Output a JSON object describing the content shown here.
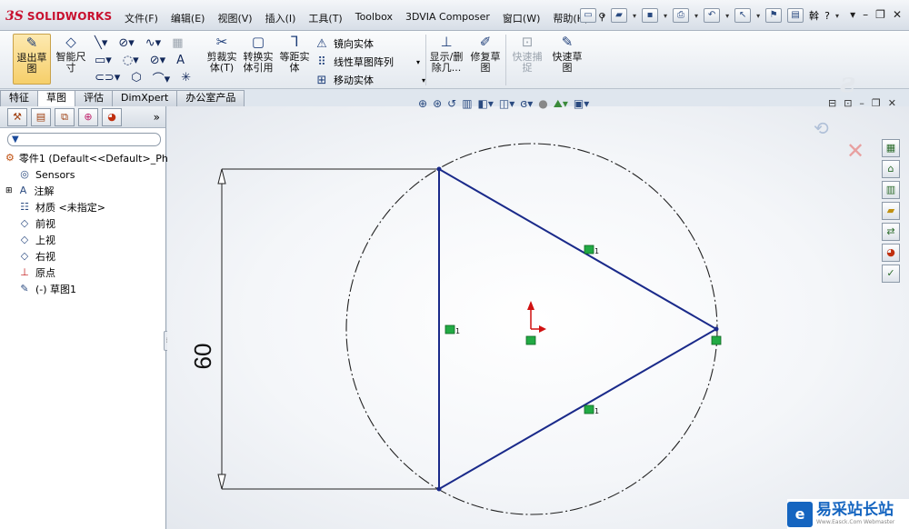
{
  "app": {
    "logo_ds": "3S",
    "logo_name": "SOLIDWORKS"
  },
  "menu": [
    "文件(F)",
    "编辑(E)",
    "视图(V)",
    "插入(I)",
    "工具(T)",
    "Toolbox",
    "3DVIA Composer",
    "窗口(W)",
    "帮助(H)"
  ],
  "toolbar_right": {
    "more_label": "斡",
    "help_label": "?"
  },
  "command_manager": {
    "exit_sketch": "退出草图",
    "smart_dim": "智能尺寸",
    "trim": "剪裁实体(T)",
    "convert": "转换实体引用",
    "offset": "等距实体",
    "mirror": "镜向实体",
    "linear_pattern": "线性草图阵列",
    "move": "移动实体",
    "display_delete": "显示/删除几...",
    "repair": "修复草图",
    "quick_snap": "快速捕捉",
    "rapid_sketch": "快速草图"
  },
  "tabs": [
    "特征",
    "草图",
    "评估",
    "DimXpert",
    "办公室产品"
  ],
  "active_tab": "草图",
  "tree": {
    "root": "零件1 (Default<<Default>_Ph",
    "items": [
      "Sensors",
      "注解",
      "材质 <未指定>",
      "前视",
      "上视",
      "右视",
      "原点",
      "(-) 草图1"
    ]
  },
  "sketch": {
    "dimension": "60",
    "relation_label": "1"
  },
  "watermark": {
    "cn": "易采站长站",
    "en": "Www.Easck.Com Webmaster"
  },
  "colors": {
    "sketch_line": "#1a2a8a",
    "construction": "#222222",
    "relation_box": "#22aa44",
    "origin_red": "#d01010"
  }
}
